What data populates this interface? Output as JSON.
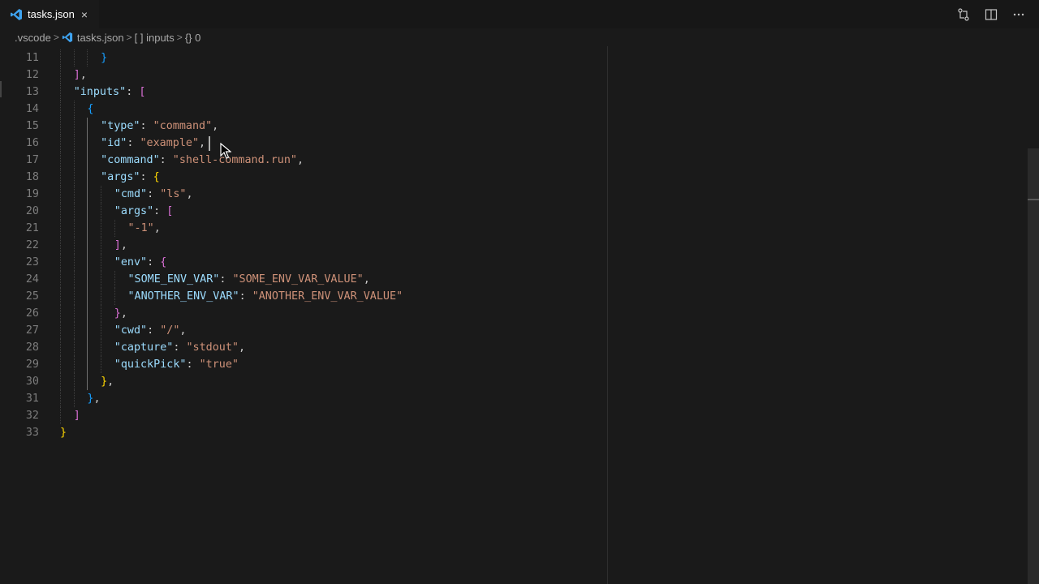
{
  "tab": {
    "filename": "tasks.json",
    "close_glyph": "×"
  },
  "breadcrumb": {
    "folder": ".vscode",
    "file": "tasks.json",
    "array_label": "[ ] inputs",
    "object_label": "{} 0"
  },
  "colors": {
    "key": "#9cdcfe",
    "string": "#ce9178",
    "bracket1": "#ffd700",
    "bracket2": "#da70d6",
    "bracket3": "#179fff",
    "background": "#1a1a1a"
  },
  "editor": {
    "lines": [
      {
        "n": "11",
        "tokens": [
          [
            "b3",
            "}"
          ]
        ]
      },
      {
        "n": "12",
        "tokens": [
          [
            "b2",
            "]"
          ],
          [
            "p",
            ","
          ]
        ]
      },
      {
        "n": "13",
        "tokens": [
          [
            "k",
            "\"inputs\""
          ],
          [
            "p",
            ": "
          ],
          [
            "b2",
            "["
          ]
        ]
      },
      {
        "n": "14",
        "tokens": [
          [
            "b3",
            "{"
          ]
        ]
      },
      {
        "n": "15",
        "tokens": [
          [
            "k",
            "\"type\""
          ],
          [
            "p",
            ": "
          ],
          [
            "s",
            "\"command\""
          ],
          [
            "p",
            ","
          ]
        ]
      },
      {
        "n": "16",
        "tokens": [
          [
            "k",
            "\"id\""
          ],
          [
            "p",
            ": "
          ],
          [
            "s",
            "\"example\""
          ],
          [
            "p",
            ","
          ]
        ]
      },
      {
        "n": "17",
        "tokens": [
          [
            "k",
            "\"command\""
          ],
          [
            "p",
            ": "
          ],
          [
            "s",
            "\"shell-command.run\""
          ],
          [
            "p",
            ","
          ]
        ]
      },
      {
        "n": "18",
        "tokens": [
          [
            "k",
            "\"args\""
          ],
          [
            "p",
            ": "
          ],
          [
            "b1",
            "{"
          ]
        ]
      },
      {
        "n": "19",
        "tokens": [
          [
            "k",
            "\"cmd\""
          ],
          [
            "p",
            ": "
          ],
          [
            "s",
            "\"ls\""
          ],
          [
            "p",
            ","
          ]
        ]
      },
      {
        "n": "20",
        "tokens": [
          [
            "k",
            "\"args\""
          ],
          [
            "p",
            ": "
          ],
          [
            "b2",
            "["
          ]
        ]
      },
      {
        "n": "21",
        "tokens": [
          [
            "s",
            "\"-1\""
          ],
          [
            "p",
            ","
          ]
        ]
      },
      {
        "n": "22",
        "tokens": [
          [
            "b2",
            "]"
          ],
          [
            "p",
            ","
          ]
        ]
      },
      {
        "n": "23",
        "tokens": [
          [
            "k",
            "\"env\""
          ],
          [
            "p",
            ": "
          ],
          [
            "b2",
            "{"
          ]
        ]
      },
      {
        "n": "24",
        "tokens": [
          [
            "k",
            "\"SOME_ENV_VAR\""
          ],
          [
            "p",
            ": "
          ],
          [
            "s",
            "\"SOME_ENV_VAR_VALUE\""
          ],
          [
            "p",
            ","
          ]
        ]
      },
      {
        "n": "25",
        "tokens": [
          [
            "k",
            "\"ANOTHER_ENV_VAR\""
          ],
          [
            "p",
            ": "
          ],
          [
            "s",
            "\"ANOTHER_ENV_VAR_VALUE\""
          ]
        ]
      },
      {
        "n": "26",
        "tokens": [
          [
            "b2",
            "}"
          ],
          [
            "p",
            ","
          ]
        ]
      },
      {
        "n": "27",
        "tokens": [
          [
            "k",
            "\"cwd\""
          ],
          [
            "p",
            ": "
          ],
          [
            "s",
            "\"/\""
          ],
          [
            "p",
            ","
          ]
        ]
      },
      {
        "n": "28",
        "tokens": [
          [
            "k",
            "\"capture\""
          ],
          [
            "p",
            ": "
          ],
          [
            "s",
            "\"stdout\""
          ],
          [
            "p",
            ","
          ]
        ]
      },
      {
        "n": "29",
        "tokens": [
          [
            "k",
            "\"quickPick\""
          ],
          [
            "p",
            ": "
          ],
          [
            "s",
            "\"true\""
          ]
        ]
      },
      {
        "n": "30",
        "tokens": [
          [
            "b1",
            "}"
          ],
          [
            "p",
            ","
          ]
        ]
      },
      {
        "n": "31",
        "tokens": [
          [
            "b3",
            "}"
          ],
          [
            "p",
            ","
          ]
        ]
      },
      {
        "n": "32",
        "tokens": [
          [
            "b2",
            "]"
          ]
        ]
      },
      {
        "n": "33",
        "tokens": [
          [
            "b1",
            "}"
          ]
        ]
      }
    ]
  }
}
